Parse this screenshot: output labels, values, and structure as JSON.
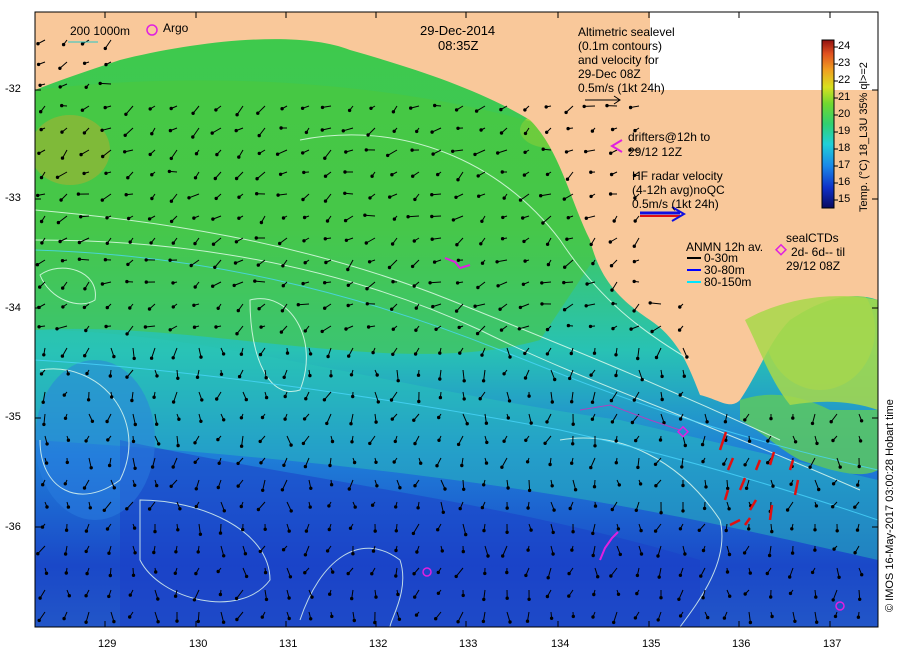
{
  "map": {
    "date": "29-Dec-2014",
    "time": "08:35Z",
    "scale_label": "200 1000m",
    "argo_label": "Argo",
    "lat_ticks": [
      "-32",
      "-33",
      "-34",
      "-35",
      "-36"
    ],
    "lon_ticks": [
      "129",
      "130",
      "131",
      "132",
      "133",
      "134",
      "135",
      "136",
      "137"
    ],
    "altimetry": {
      "lines": [
        "Altimetric sealevel",
        "(0.1m contours)",
        "and velocity for",
        "29-Dec 08Z",
        "0.5m/s (1kt 24h)"
      ]
    },
    "drifters": {
      "lines": [
        "drifters@12h to",
        "29/12 12Z"
      ]
    },
    "hf_radar": {
      "lines": [
        "HF radar velocity",
        "(4-12h avg)noQC",
        "0.5m/s (1kt 24h)"
      ]
    },
    "anmn": {
      "title": "ANMN 12h av.",
      "items": [
        {
          "label": "0-30m",
          "color": "#000000"
        },
        {
          "label": "30-80m",
          "color": "#0000ff"
        },
        {
          "label": "80-150m",
          "color": "#00e5ff"
        }
      ]
    },
    "seal": {
      "lines": [
        "sealCTDs",
        "2d- 6d-- til",
        "29/12 08Z"
      ]
    },
    "colorbar": {
      "ticks": [
        "24",
        "23",
        "22",
        "21",
        "20",
        "19",
        "18",
        "17",
        "16",
        "15"
      ],
      "label": "Temp. (°C) 18_L3U 35% ql>=2"
    },
    "credit": "© IMOS 16-May-2017 03:00:28 Hobart time",
    "colors": {
      "land": "#f9c89a",
      "ocean_warm": "#5cd24e",
      "ocean_mid": "#22c8c8",
      "ocean_cold": "#1a5ad8",
      "argo_marker": "#e020e0"
    }
  }
}
